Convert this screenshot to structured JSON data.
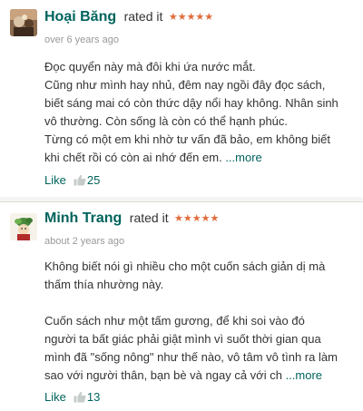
{
  "reviews": [
    {
      "name": "Hoại Băng",
      "rated_label": "rated it",
      "stars": "★★★★★",
      "date": "over 6 years ago",
      "lines": [
        "Đọc quyển này mà đôi khi ứa nước mắt.",
        "Cũng như mình hay nhủ, đêm nay ngồi đây đọc sách,",
        "biết sáng mai có còn thức dậy nổi hay không. Nhân sinh",
        "vô thường. Còn sống là còn có thể hạnh phúc.",
        "Từng có một em khi nhờ tư vấn đã bảo, em không biết",
        "khi chết rồi có còn ai nhớ đến em."
      ],
      "more": "...more",
      "like_label": "Like",
      "like_count": "25",
      "avatar_icon": "user-avatar-photo"
    },
    {
      "name": "Minh Trang",
      "rated_label": "rated it",
      "stars": "★★★★★",
      "date": "about 2 years ago",
      "lines": [
        "Không biết nói gì nhiều cho một cuốn sách giản dị mà",
        "thấm thía nhường này.",
        "",
        "Cuốn sách như một tấm gương, để khi soi vào đó",
        "người ta bất giác phải giật mình vì suốt thời gian qua",
        "mình đã \"sống nông\" như thế nào, vô tâm vô tình ra làm",
        "sao với người thân, bạn bè và ngay cả với ch"
      ],
      "more": "...more",
      "like_label": "Like",
      "like_count": "13",
      "avatar_icon": "user-avatar-photo"
    }
  ],
  "colors": {
    "accent": "#00635d",
    "stars": "#e06c3c",
    "muted": "#999999",
    "text": "#333333",
    "background": "#f4f4f2"
  }
}
